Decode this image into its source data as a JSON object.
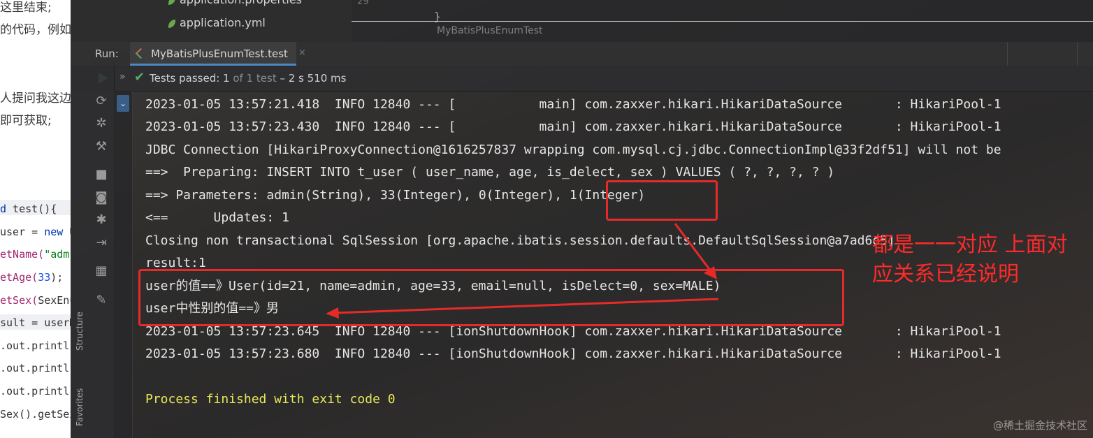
{
  "article": {
    "texts": [
      "这里结束;",
      "的代码，例如",
      "人提问我这边",
      "即可获取;"
    ],
    "code": {
      "l1_kw": "d",
      "l1_name": " test(){",
      "l2_a": "user = ",
      "l2_kw": "new",
      "l2_b": " U",
      "l3_fn": "etName(",
      "l3_str": "\"adm",
      "l4_fn": "etAge(",
      "l4_num": "33",
      "l4_b": ");",
      "l5_fn": "etSex(",
      "l5_b": "SexEnu",
      "l6": "sult = userM",
      "l7": ".out.printl",
      "l8": ".out.printl",
      "l9": ".out.printl",
      "l10": "Sex().getSex"
    }
  },
  "project": {
    "items": [
      "application.properties",
      "application.yml"
    ]
  },
  "editor": {
    "line_number": "29",
    "brace": "}",
    "breadcrumb": "MyBatisPlusEnumTest"
  },
  "run": {
    "label": "Run:",
    "tab_label": "MyBatisPlusEnumTest.test",
    "close": "×"
  },
  "status": {
    "chevron": "»",
    "passed": "Tests passed: 1",
    "of": " of 1 test",
    "time": " – 2 s 510 ms"
  },
  "sidebar": {
    "structure": "Structure",
    "favorites": "Favorites"
  },
  "console": {
    "lines": [
      "2023-01-05 13:57:21.418  INFO 12840 --- [           main] com.zaxxer.hikari.HikariDataSource       : HikariPool-1",
      "2023-01-05 13:57:23.430  INFO 12840 --- [           main] com.zaxxer.hikari.HikariDataSource       : HikariPool-1",
      "JDBC Connection [HikariProxyConnection@1616257837 wrapping com.mysql.cj.jdbc.ConnectionImpl@33f2df51] will not be",
      "==>  Preparing: INSERT INTO t_user ( user_name, age, is_delect, sex ) VALUES ( ?, ?, ?, ? )",
      "==> Parameters: admin(String), 33(Integer), 0(Integer), 1(Integer)",
      "<==      Updates: 1",
      "Closing non transactional SqlSession [org.apache.ibatis.session.defaults.DefaultSqlSession@a7ad6e5]",
      "result:1",
      "user的值==》User(id=21, name=admin, age=33, email=null, isDelect=0, sex=MALE)",
      "user中性别的值==》男",
      "2023-01-05 13:57:23.645  INFO 12840 --- [ionShutdownHook] com.zaxxer.hikari.HikariDataSource       : HikariPool-1",
      "2023-01-05 13:57:23.680  INFO 12840 --- [ionShutdownHook] com.zaxxer.hikari.HikariDataSource       : HikariPool-1",
      "",
      "Process finished with exit code 0"
    ]
  },
  "annotation": {
    "line1": "都是一一对应 上面对",
    "line2": "应关系已经说明"
  },
  "watermark": "@稀土掘金技术社区",
  "colors": {
    "annotation_red": "#e62a2a",
    "success_green": "#59a869",
    "exit_yellow": "#e7e85a"
  }
}
